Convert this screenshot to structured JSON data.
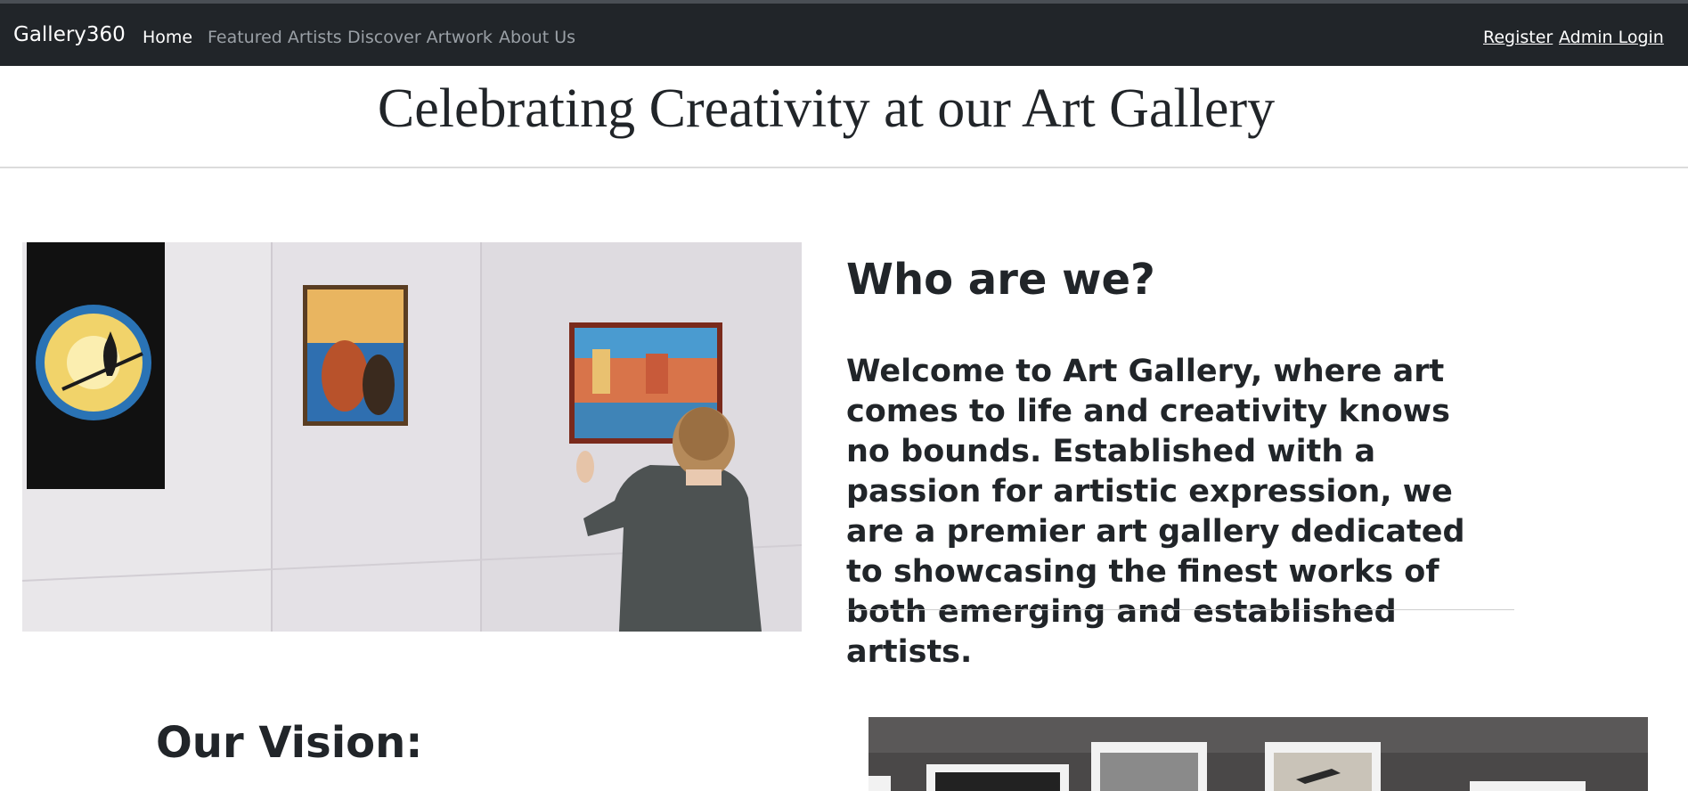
{
  "navbar": {
    "brand": "Gallery360",
    "items": [
      {
        "label": "Home",
        "active": true
      },
      {
        "label": "Featured Artists",
        "active": false
      },
      {
        "label": "Discover Artwork",
        "active": false
      },
      {
        "label": "About Us",
        "active": false
      }
    ],
    "right": {
      "register": "Register",
      "admin_login": "Admin Login"
    }
  },
  "page": {
    "title": "Celebrating Creativity at our Art Gallery"
  },
  "about": {
    "heading": "Who are we?",
    "text": "Welcome to Art Gallery, where art comes to life and creativity knows no bounds. Established with a passion for artistic expression, we are a premier art gallery dedicated to showcasing the finest works of both emerging and established artists."
  },
  "vision": {
    "heading": "Our Vision:"
  },
  "colors": {
    "navbar_bg": "#212529",
    "nav_inactive": "#9aa0a6",
    "nav_active": "#ffffff",
    "text": "#212529"
  }
}
